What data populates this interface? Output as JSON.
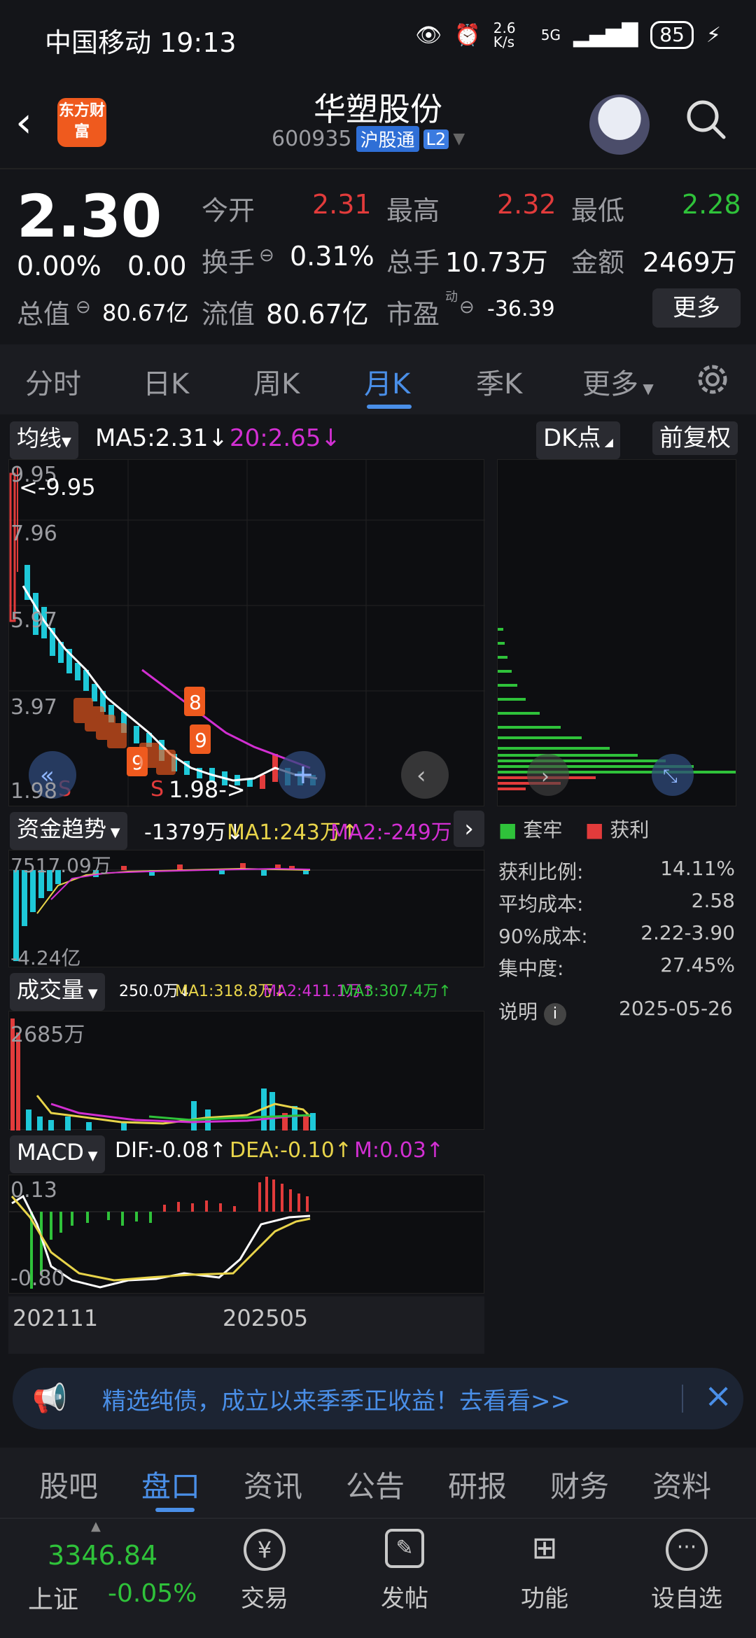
{
  "status": {
    "carrier_time": "中国移动 19:13",
    "net_speed": "2.6 K/s",
    "signal": "5G",
    "battery": "85"
  },
  "header": {
    "logo_text": "东方财富",
    "title": "华塑股份",
    "code": "600935",
    "tag_hgt": "沪股通",
    "tag_l2": "L2"
  },
  "quote": {
    "price": "2.30",
    "change_pct": "0.00%",
    "change_amt": "0.00",
    "open_label": "今开",
    "open": "2.31",
    "high_label": "最高",
    "high": "2.32",
    "low_label": "最低",
    "low": "2.28",
    "turnover_label": "换手",
    "turnover": "0.31%",
    "volume_label": "总手",
    "volume": "10.73万",
    "amount_label": "金额",
    "amount": "2469万",
    "mcap_label": "总值",
    "mcap": "80.67亿",
    "float_label": "流值",
    "float_cap": "80.67亿",
    "pe_label": "市盈",
    "pe_sup": "动",
    "pe": "-36.39",
    "more": "更多"
  },
  "tabs": [
    "分时",
    "日K",
    "周K",
    "月K",
    "季K",
    "更多"
  ],
  "kline": {
    "ma_btn": "均线",
    "ma5": "MA5:2.31↓",
    "ma20": "20:2.65↓",
    "dk_btn": "DK点",
    "adj_btn": "前复权",
    "y_ticks": [
      "9.95",
      "7.96",
      "5.97",
      "3.97",
      "1.98"
    ],
    "max_note": "<-9.95",
    "min_note": "1.98->"
  },
  "fund": {
    "btn": "资金趋势",
    "val": "-1379万↓",
    "ma1": "MA1:243万↑",
    "ma2": "MA2:-249万↓",
    "top": "7517.09万",
    "bottom": "-4.24亿"
  },
  "vol": {
    "btn": "成交量",
    "val": "250.0万↓",
    "ma1": "MA1:318.8万↓",
    "ma2": "MA2:411.1万↑",
    "ma3": "MA3:307.4万↑",
    "top": "2685万"
  },
  "macd": {
    "btn": "MACD",
    "dif": "DIF:-0.08↑",
    "dea": "DEA:-0.10↑",
    "m": "M:0.03↑",
    "top": "0.13",
    "bottom": "-0.80",
    "x_start": "202111",
    "x_end": "202505"
  },
  "chips": {
    "legend_trapped": "套牢",
    "legend_profit": "获利",
    "profit_ratio_label": "获利比例:",
    "profit_ratio": "14.11%",
    "avg_cost_label": "平均成本:",
    "avg_cost": "2.58",
    "cost90_label": "90%成本:",
    "cost90": "2.22-3.90",
    "concentration_label": "集中度:",
    "concentration": "27.45%",
    "explain": "说明",
    "date": "2025-05-26"
  },
  "ad": {
    "text": "精选纯债，成立以来季季正收益！去看看>>"
  },
  "bottom_tabs": [
    "股吧",
    "盘口",
    "资讯",
    "公告",
    "研报",
    "财务",
    "资料"
  ],
  "index": {
    "value": "3346.84",
    "name": "上证",
    "change": "-0.05%"
  },
  "actions": [
    "交易",
    "发帖",
    "功能",
    "设自选"
  ],
  "colors": {
    "up": "#e23b3b",
    "down": "#2fc23a",
    "accent": "#4a8fe8",
    "ma20": "#d22fd2",
    "ma5": "#ffffff"
  }
}
